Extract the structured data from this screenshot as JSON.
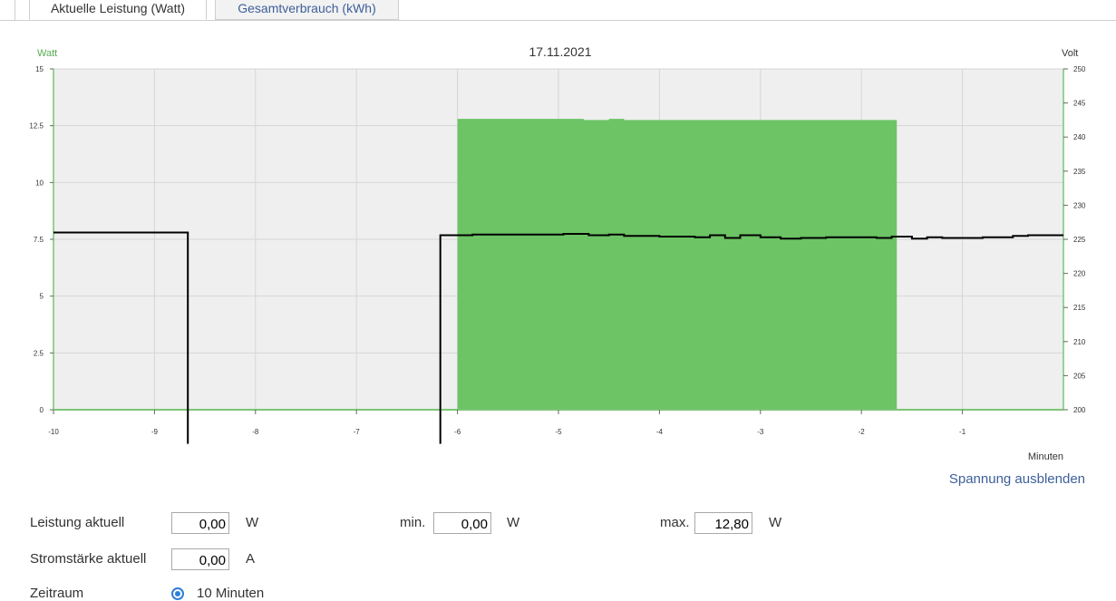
{
  "tabs": [
    {
      "label": "Aktuelle Leistung (Watt)",
      "active": true
    },
    {
      "label": "Gesamtverbrauch (kWh)",
      "active": false
    }
  ],
  "chart_data": {
    "type": "area",
    "title": "17.11.2021",
    "left_axis_label": "Watt",
    "right_axis_label": "Volt",
    "x_axis_label": "Minuten",
    "xlim": [
      -10,
      0
    ],
    "x_ticks": [
      "-10",
      "-9",
      "-8",
      "-7",
      "-6",
      "-5",
      "-4",
      "-3",
      "-2",
      "-1"
    ],
    "ylim_left": [
      0,
      15
    ],
    "y_ticks_left": [
      "0",
      "2.5",
      "5",
      "7.5",
      "10",
      "12.5",
      "15"
    ],
    "ylim_right": [
      200,
      250
    ],
    "y_ticks_right": [
      "200",
      "205",
      "210",
      "215",
      "220",
      "225",
      "230",
      "235",
      "240",
      "245",
      "250"
    ],
    "grid": true,
    "colors": {
      "power": "#6cc465",
      "voltage": "#000000",
      "plot_bg": "#efefef",
      "axis_green": "#7cc576"
    },
    "series": [
      {
        "name": "Leistung",
        "axis": "left",
        "points": [
          [
            -10,
            0
          ],
          [
            -6,
            0
          ],
          [
            -6,
            12.8
          ],
          [
            -4.75,
            12.8
          ],
          [
            -4.75,
            12.75
          ],
          [
            -4.5,
            12.75
          ],
          [
            -4.5,
            12.8
          ],
          [
            -4.35,
            12.8
          ],
          [
            -4.35,
            12.75
          ],
          [
            -1.65,
            12.75
          ],
          [
            -1.65,
            0
          ],
          [
            0,
            0
          ]
        ]
      },
      {
        "name": "Spannung",
        "axis": "right",
        "segments": [
          [
            [
              -10,
              226.0
            ],
            [
              -8.67,
              226.0
            ],
            [
              -8.67,
              195
            ]
          ],
          [
            [
              -6.17,
              195
            ],
            [
              -6.17,
              225.6
            ],
            [
              -6.0,
              225.6
            ],
            [
              -5.85,
              225.7
            ],
            [
              -5.1,
              225.7
            ],
            [
              -4.95,
              225.8
            ],
            [
              -4.8,
              225.8
            ],
            [
              -4.7,
              225.6
            ],
            [
              -4.5,
              225.7
            ],
            [
              -4.35,
              225.5
            ],
            [
              -4.0,
              225.4
            ],
            [
              -3.65,
              225.3
            ],
            [
              -3.5,
              225.6
            ],
            [
              -3.35,
              225.2
            ],
            [
              -3.2,
              225.6
            ],
            [
              -3.0,
              225.3
            ],
            [
              -2.8,
              225.1
            ],
            [
              -2.6,
              225.2
            ],
            [
              -2.35,
              225.3
            ],
            [
              -1.85,
              225.2
            ],
            [
              -1.7,
              225.4
            ],
            [
              -1.5,
              225.1
            ],
            [
              -1.35,
              225.3
            ],
            [
              -1.2,
              225.2
            ],
            [
              -0.8,
              225.3
            ],
            [
              -0.65,
              225.3
            ],
            [
              -0.5,
              225.5
            ],
            [
              -0.35,
              225.6
            ],
            [
              -0.2,
              225.6
            ],
            [
              0,
              225.6
            ]
          ]
        ]
      }
    ]
  },
  "voltage_toggle": "Spannung ausblenden",
  "form": {
    "power_label": "Leistung aktuell",
    "power_value": "0,00",
    "power_unit": "W",
    "min_label": "min.",
    "min_value": "0,00",
    "min_unit": "W",
    "max_label": "max.",
    "max_value": "12,80",
    "max_unit": "W",
    "current_label": "Stromstärke aktuell",
    "current_value": "0,00",
    "current_unit": "A",
    "period_label": "Zeitraum",
    "period_option": "10 Minuten"
  }
}
